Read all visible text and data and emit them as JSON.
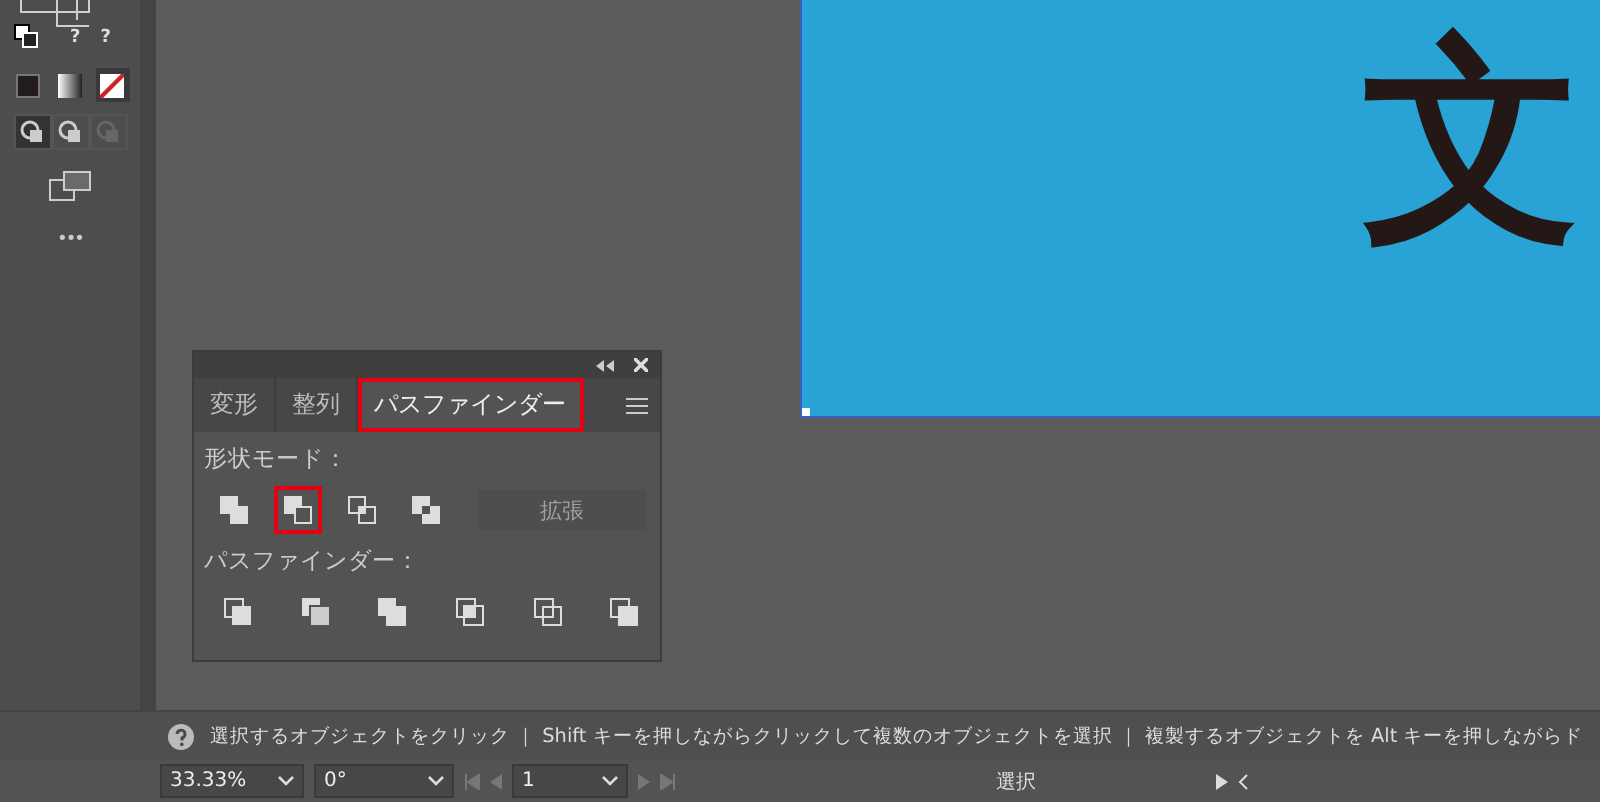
{
  "toolbar": {
    "swatch_marks": [
      "?",
      "?"
    ],
    "color_modes": [
      {
        "kind": "color",
        "selected": false
      },
      {
        "kind": "gradient",
        "selected": false
      },
      {
        "kind": "none",
        "selected": true
      }
    ],
    "draw_modes": [
      {
        "selected": true,
        "disabled": false
      },
      {
        "selected": false,
        "disabled": false
      },
      {
        "selected": false,
        "disabled": true
      }
    ],
    "more": "•••"
  },
  "artboard": {
    "glyph": "文"
  },
  "panel": {
    "tabs": [
      {
        "label": "変形",
        "selected": false,
        "highlighted": false
      },
      {
        "label": "整列",
        "selected": false,
        "highlighted": false
      },
      {
        "label": "パスファインダー",
        "selected": true,
        "highlighted": true
      }
    ],
    "shape_modes": {
      "label": "形状モード：",
      "buttons": [
        {
          "highlighted": false
        },
        {
          "highlighted": true
        },
        {
          "highlighted": false
        },
        {
          "highlighted": false
        }
      ],
      "expand": {
        "label": "拡張",
        "disabled": true
      }
    },
    "pathfinders": {
      "label": "パスファインダー："
    }
  },
  "status_bar": {
    "message": "選択するオブジェクトをクリック ｜ Shift キーを押しながらクリックして複数のオブジェクトを選択 ｜ 複製するオブジェクトを Alt キーを押しながらド"
  },
  "bottom_bar": {
    "zoom": "33.33%",
    "rotation": "0°",
    "page": "1",
    "mode": "選択"
  }
}
